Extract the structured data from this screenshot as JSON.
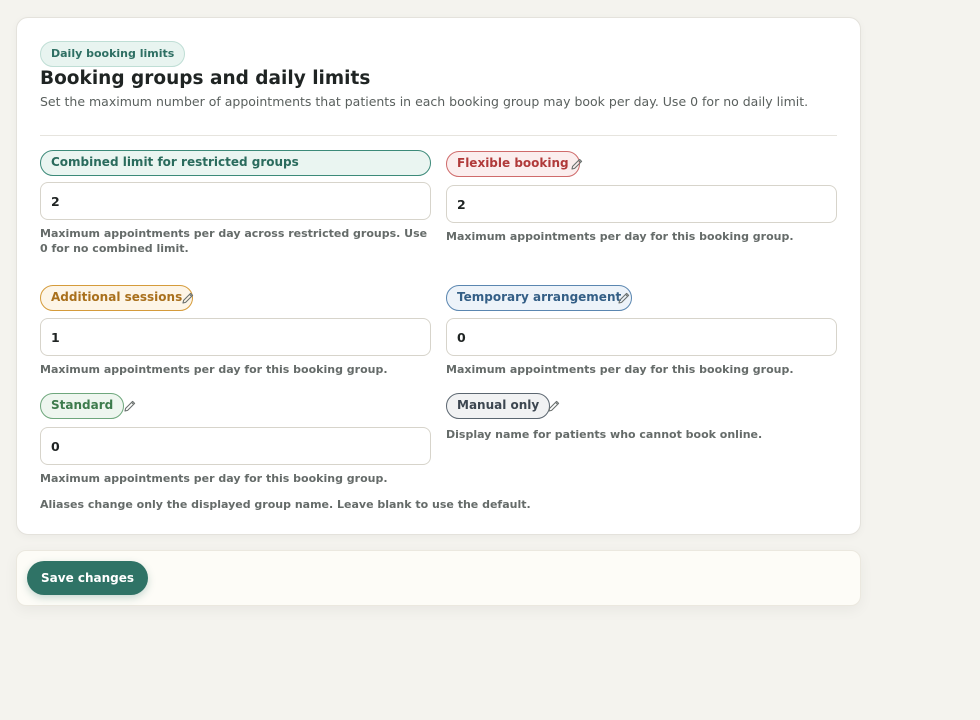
{
  "header": {
    "eyebrow": "Daily booking limits",
    "title": "Booking groups and daily limits",
    "description": "Set the maximum number of appointments that patients in each booking group may book per day. Use 0 for no daily limit."
  },
  "groups": {
    "combined": {
      "label": "Combined limit for restricted groups",
      "value": "2",
      "hint": "Maximum appointments per day across restricted groups. Use 0 for no combined limit."
    },
    "flexible": {
      "label": "Flexible booking",
      "value": "2",
      "hint": "Maximum appointments per day for this booking group."
    },
    "additional": {
      "label": "Additional sessions",
      "value": "1",
      "hint": "Maximum appointments per day for this booking group."
    },
    "temporary": {
      "label": "Temporary arrangement",
      "value": "0",
      "hint": "Maximum appointments per day for this booking group."
    },
    "standard": {
      "label": "Standard",
      "value": "0",
      "hint": "Maximum appointments per day for this booking group."
    },
    "manual": {
      "label": "Manual only",
      "hint": "Display name for patients who cannot book online."
    }
  },
  "aliases_note": "Aliases change only the displayed group name. Leave blank to use the default.",
  "footer": {
    "save_label": "Save changes"
  },
  "colors": {
    "accent": "#2f7366",
    "background": "#f4f3ee",
    "flexible": "#b03a3a",
    "additional": "#a9701c",
    "temporary": "#345f86",
    "standard": "#3d7b4c",
    "manual": "#3c4650"
  },
  "icons": {
    "edit": "pencil-icon"
  }
}
